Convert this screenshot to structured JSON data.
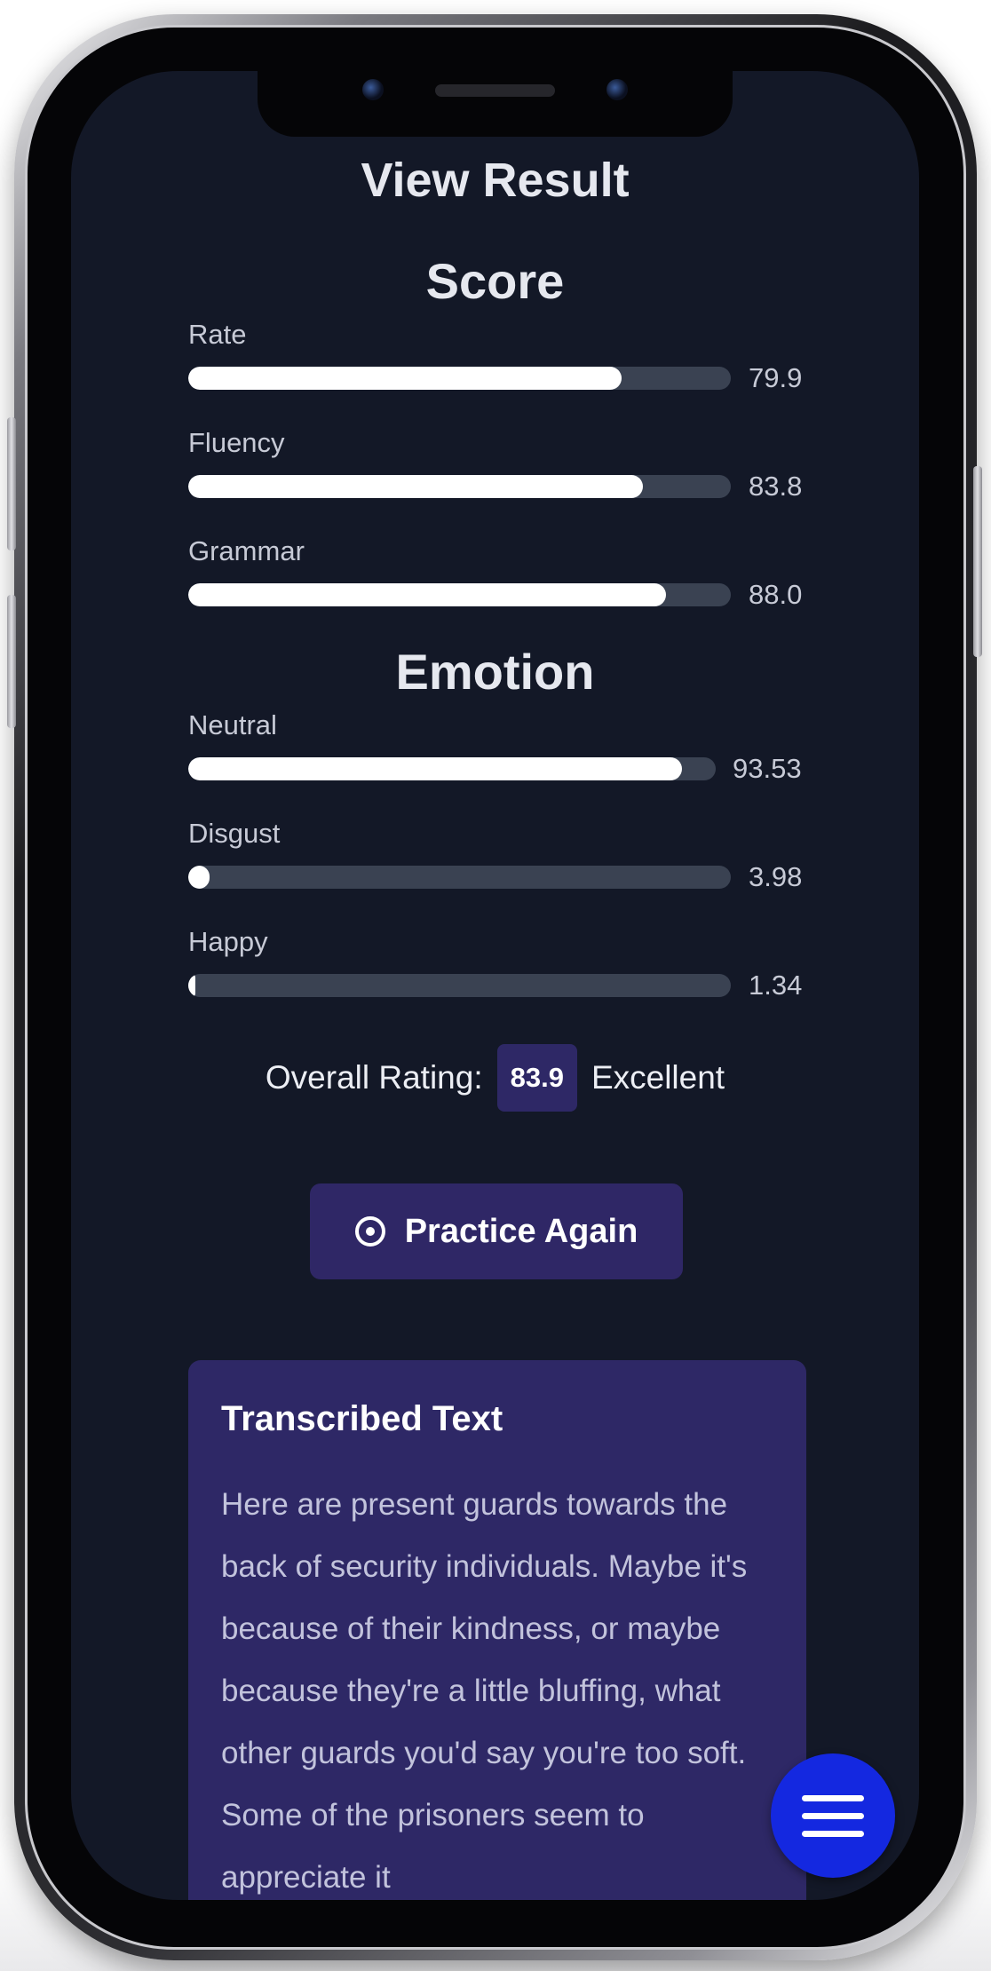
{
  "header": {
    "title": "View Result"
  },
  "score": {
    "heading": "Score",
    "metrics": [
      {
        "label": "Rate",
        "value": "79.9",
        "fraction": 0.799
      },
      {
        "label": "Fluency",
        "value": "83.8",
        "fraction": 0.838
      },
      {
        "label": "Grammar",
        "value": "88.0",
        "fraction": 0.88
      }
    ]
  },
  "emotion": {
    "heading": "Emotion",
    "metrics": [
      {
        "label": "Neutral",
        "value": "93.53",
        "fraction": 0.9353
      },
      {
        "label": "Disgust",
        "value": "3.98",
        "fraction": 0.0398
      },
      {
        "label": "Happy",
        "value": "1.34",
        "fraction": 0.0134
      }
    ]
  },
  "overall": {
    "label": "Overall Rating:",
    "value": "83.9",
    "verdict": "Excellent"
  },
  "actions": {
    "practice_again_label": "Practice Again"
  },
  "transcription": {
    "title": "Transcribed Text",
    "text": "Here are present guards towards the back of security individuals. Maybe it's because of their kindness, or maybe because they're a little bluffing, what other guards you'd say you're too soft. Some of the prisoners seem to appreciate it"
  },
  "icons": {
    "practice": "target-icon",
    "menu": "hamburger-menu-icon"
  },
  "colors": {
    "background": "#131827",
    "accent": "#2e2866",
    "fab": "#1428e0",
    "bar_fill": "#ffffff",
    "bar_track": "#3a4252"
  }
}
